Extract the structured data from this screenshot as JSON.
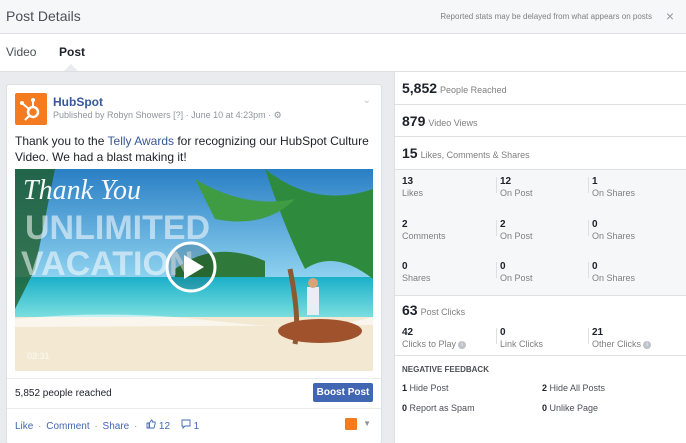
{
  "header": {
    "title": "Post Details",
    "note": "Reported stats may be delayed from what appears on posts",
    "close_icon": "×"
  },
  "tabs": [
    {
      "label": "Video"
    },
    {
      "label": "Post"
    }
  ],
  "post": {
    "page_name": "HubSpot",
    "byline": "Published by Robyn Showers [?] · June 10 at 4:23pm · ⚙",
    "chevron": "⌄",
    "text_before": "Thank you to the ",
    "text_link": "Telly Awards",
    "text_after": " for recognizing our HubSpot Culture Video. We had a blast making it!",
    "video_time": "03:31",
    "reach_text": "5,852 people reached",
    "boost_label": "Boost Post",
    "actions": {
      "like": "Like",
      "comment": "Comment",
      "share": "Share",
      "likes_count": "12",
      "comments_count": "1"
    },
    "colors": {
      "brand": "#f47b20",
      "link": "#365899",
      "button": "#4267b2"
    }
  },
  "stats": {
    "people_reached": {
      "value": "5,852",
      "label": "People Reached"
    },
    "video_views": {
      "value": "879",
      "label": "Video Views"
    },
    "engagement": {
      "value": "15",
      "label": "Likes, Comments & Shares"
    },
    "grid": [
      [
        {
          "v": "13",
          "l": "Likes"
        },
        {
          "v": "12",
          "l": "On Post"
        },
        {
          "v": "1",
          "l": "On Shares"
        }
      ],
      [
        {
          "v": "2",
          "l": "Comments"
        },
        {
          "v": "2",
          "l": "On Post"
        },
        {
          "v": "0",
          "l": "On Shares"
        }
      ],
      [
        {
          "v": "0",
          "l": "Shares"
        },
        {
          "v": "0",
          "l": "On Post"
        },
        {
          "v": "0",
          "l": "On Shares"
        }
      ]
    ],
    "post_clicks": {
      "value": "63",
      "label": "Post Clicks"
    },
    "clicks": [
      {
        "v": "42",
        "l": "Clicks to Play"
      },
      {
        "v": "0",
        "l": "Link Clicks"
      },
      {
        "v": "21",
        "l": "Other Clicks"
      }
    ],
    "negative": {
      "title": "NEGATIVE FEEDBACK",
      "items": [
        {
          "v": "1",
          "l": "Hide Post"
        },
        {
          "v": "2",
          "l": "Hide All Posts"
        },
        {
          "v": "0",
          "l": "Report as Spam"
        },
        {
          "v": "0",
          "l": "Unlike Page"
        }
      ]
    }
  }
}
